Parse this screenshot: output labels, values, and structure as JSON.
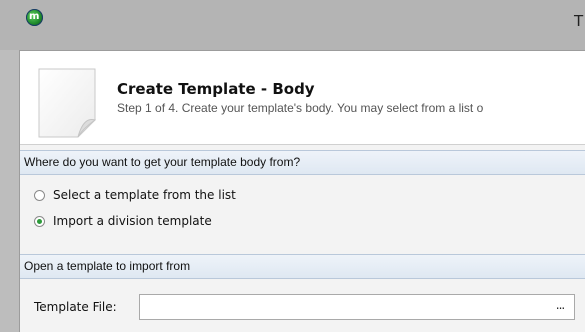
{
  "window": {
    "title": "T",
    "app_icon": "mi-app-icon"
  },
  "header": {
    "title": "Create Template - Body",
    "subtitle": "Step 1 of 4. Create your template's body. You may select from a list o",
    "icon": "document-icon"
  },
  "source_section": {
    "heading": "Where do you want to get your template body from?",
    "options": [
      {
        "label": "Select a template from the list",
        "selected": false
      },
      {
        "label": "Import a division template",
        "selected": true
      }
    ]
  },
  "import_section": {
    "heading": "Open a template to import from",
    "file_label": "Template File:",
    "file_value": "",
    "browse_label": "..."
  },
  "colors": {
    "radio_selected": "#2c9a3a",
    "section_bar": "#dfe8f2"
  }
}
